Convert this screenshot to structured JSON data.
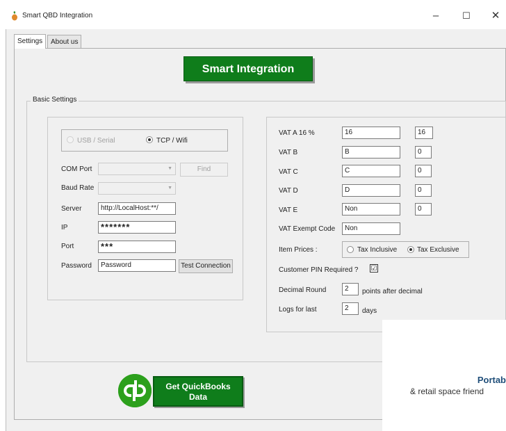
{
  "window": {
    "title": "Smart QBD Integration",
    "controls": [
      "–",
      "☐",
      "✕"
    ]
  },
  "tabs": [
    {
      "label": "Settings",
      "active": true
    },
    {
      "label": "About us",
      "active": false
    }
  ],
  "banner": "Smart Integration",
  "basic_settings": {
    "label": "Basic Settings",
    "connection": {
      "options": [
        {
          "label": "USB / Serial",
          "selected": false,
          "enabled": false
        },
        {
          "label": "TCP / Wifi",
          "selected": true,
          "enabled": true
        }
      ],
      "fields": {
        "com_port": {
          "label": "COM Port",
          "value": ""
        },
        "find_button": "Find",
        "baud_rate": {
          "label": "Baud Rate",
          "value": ""
        },
        "server": {
          "label": "Server",
          "value": "http://LocalHost:**/"
        },
        "ip": {
          "label": "IP",
          "value": "*******"
        },
        "port": {
          "label": "Port",
          "value": "***"
        },
        "password": {
          "label": "Password",
          "value": "Password"
        },
        "test_button": "Test Connection"
      }
    },
    "vat": {
      "rows": [
        {
          "label": "VAT A 16 %",
          "code": "16",
          "rate": "16"
        },
        {
          "label": "VAT B",
          "code": "B",
          "rate": "0"
        },
        {
          "label": "VAT C",
          "code": "C",
          "rate": "0"
        },
        {
          "label": "VAT D",
          "code": "D",
          "rate": "0"
        },
        {
          "label": "VAT E",
          "code": "Non",
          "rate": "0"
        }
      ],
      "exempt": {
        "label": "VAT Exempt Code",
        "value": "Non"
      },
      "item_prices": {
        "label": "Item Prices :",
        "options": [
          {
            "label": "Tax Inclusive",
            "selected": false
          },
          {
            "label": "Tax Exclusive",
            "selected": true
          }
        ]
      },
      "customer_pin": {
        "label": "Customer PIN Required ?",
        "checked": true,
        "mark": "☑"
      },
      "decimal_round": {
        "label": "Decimal Round",
        "value": "2",
        "suffix": "points after decimal"
      },
      "logs": {
        "label": "Logs for last",
        "value": "2",
        "suffix": "days"
      }
    }
  },
  "quickbooks": {
    "logo_text": "qb",
    "button": {
      "line1": "Get QuickBooks",
      "line2": "Data"
    }
  },
  "overlay": {
    "title": "Portab",
    "subtitle": "& retail space friend"
  }
}
